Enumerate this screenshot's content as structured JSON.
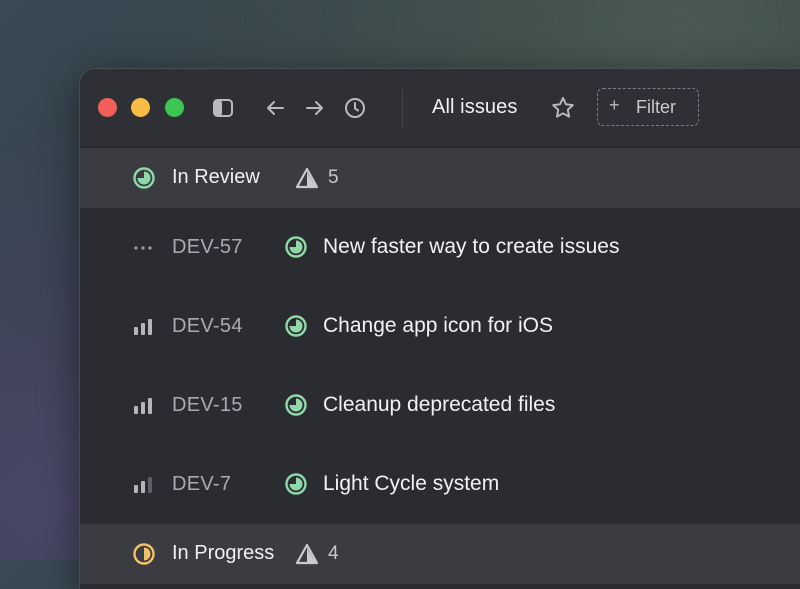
{
  "titlebar": {
    "view_title": "All issues",
    "filter_label": "Filter",
    "filter_plus": "+"
  },
  "colors": {
    "review_status": "#8fd8a8",
    "progress_status": "#f2c265",
    "warning": "#c9cbd1"
  },
  "groups": [
    {
      "label": "In Review",
      "count": "5",
      "status_icon": "in-review-status-icon"
    },
    {
      "label": "In Progress",
      "count": "4",
      "status_icon": "in-progress-status-icon"
    }
  ],
  "issues": [
    {
      "id": "DEV-57",
      "title": "New faster way to create issues",
      "priority": "no-priority"
    },
    {
      "id": "DEV-54",
      "title": "Change app icon for iOS",
      "priority": "high"
    },
    {
      "id": "DEV-15",
      "title": "Cleanup deprecated files",
      "priority": "high"
    },
    {
      "id": "DEV-7",
      "title": "Light Cycle system",
      "priority": "medium"
    }
  ]
}
